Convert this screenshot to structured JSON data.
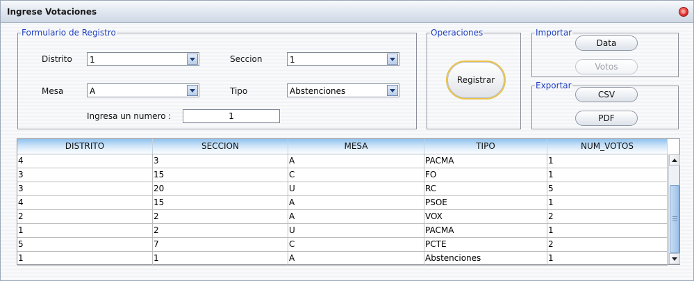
{
  "window": {
    "title": "Ingrese Votaciones"
  },
  "formulario": {
    "legend": "Formulario de Registro",
    "distrito": {
      "label": "Distrito",
      "value": "1"
    },
    "seccion": {
      "label": "Seccion",
      "value": "1"
    },
    "mesa": {
      "label": "Mesa",
      "value": "A"
    },
    "tipo": {
      "label": "Tipo",
      "value": "Abstenciones"
    },
    "numero": {
      "label": "Ingresa un numero :",
      "value": "1"
    }
  },
  "operaciones": {
    "legend": "Operaciones",
    "registrar_label": "Registrar"
  },
  "importar": {
    "legend": "Importar",
    "data_label": "Data",
    "votos_label": "Votos"
  },
  "exportar": {
    "legend": "Exportar",
    "csv_label": "CSV",
    "pdf_label": "PDF"
  },
  "table": {
    "columns": [
      "DISTRITO",
      "SECCION",
      "MESA",
      "TIPO",
      "NUM_VOTOS"
    ],
    "rows": [
      [
        "4",
        "3",
        "A",
        "PACMA",
        "1"
      ],
      [
        "3",
        "15",
        "C",
        "FO",
        "1"
      ],
      [
        "3",
        "20",
        "U",
        "RC",
        "5"
      ],
      [
        "4",
        "15",
        "A",
        "PSOE",
        "1"
      ],
      [
        "2",
        "2",
        "A",
        "VOX",
        "2"
      ],
      [
        "1",
        "2",
        "U",
        "PACMA",
        "1"
      ],
      [
        "5",
        "7",
        "C",
        "PCTE",
        "2"
      ],
      [
        "1",
        "1",
        "A",
        "Abstenciones",
        "1"
      ]
    ]
  }
}
